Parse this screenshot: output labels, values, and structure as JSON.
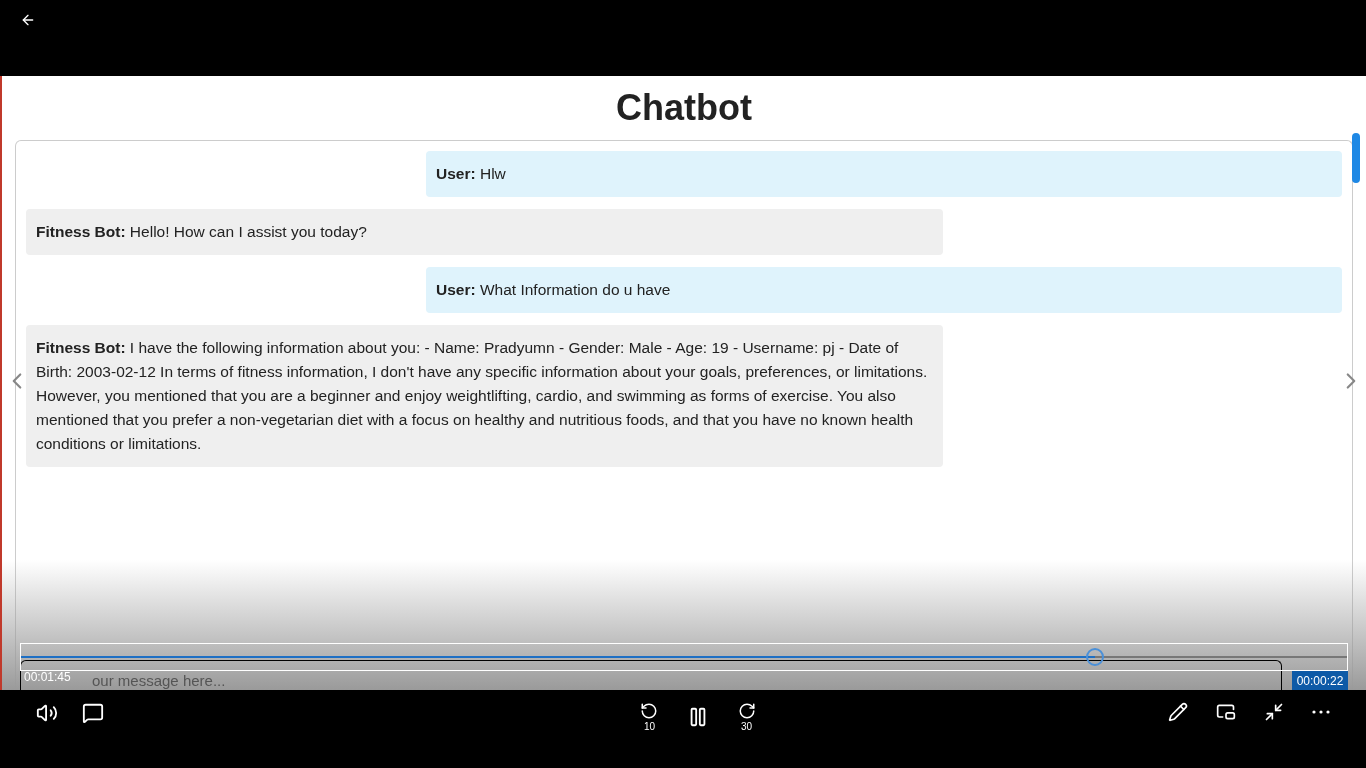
{
  "video": {
    "page_title": "Chatbot",
    "messages": [
      {
        "kind": "user",
        "text": "**User:** Hlw"
      },
      {
        "kind": "bot",
        "text": "**Fitness Bot:** Hello! How can I assist you today?"
      },
      {
        "kind": "user",
        "text": "**User:** What Information do u have"
      },
      {
        "kind": "bot",
        "text": "**Fitness Bot:** I have the following information about you: - Name: Pradyumn - Gender: Male - Age: 19 - Username: pj - Date of Birth: 2003-02-12 In terms of fitness information, I don't have any specific information about your goals, preferences, or limitations. However, you mentioned that you are a beginner and enjoy weightlifting, cardio, and swimming as forms of exercise. You also mentioned that you prefer a non-vegetarian diet with a focus on healthy and nutritious foods, and that you have no known health conditions or limitations."
      }
    ],
    "input": {
      "placeholder": "our message here..."
    }
  },
  "player": {
    "seek": {
      "level": 0.81,
      "elapsed": "00:01:45",
      "remaining": "00:00:22"
    },
    "rewind": {
      "label": "10"
    },
    "forward": {
      "label": "30"
    },
    "playing": true
  }
}
